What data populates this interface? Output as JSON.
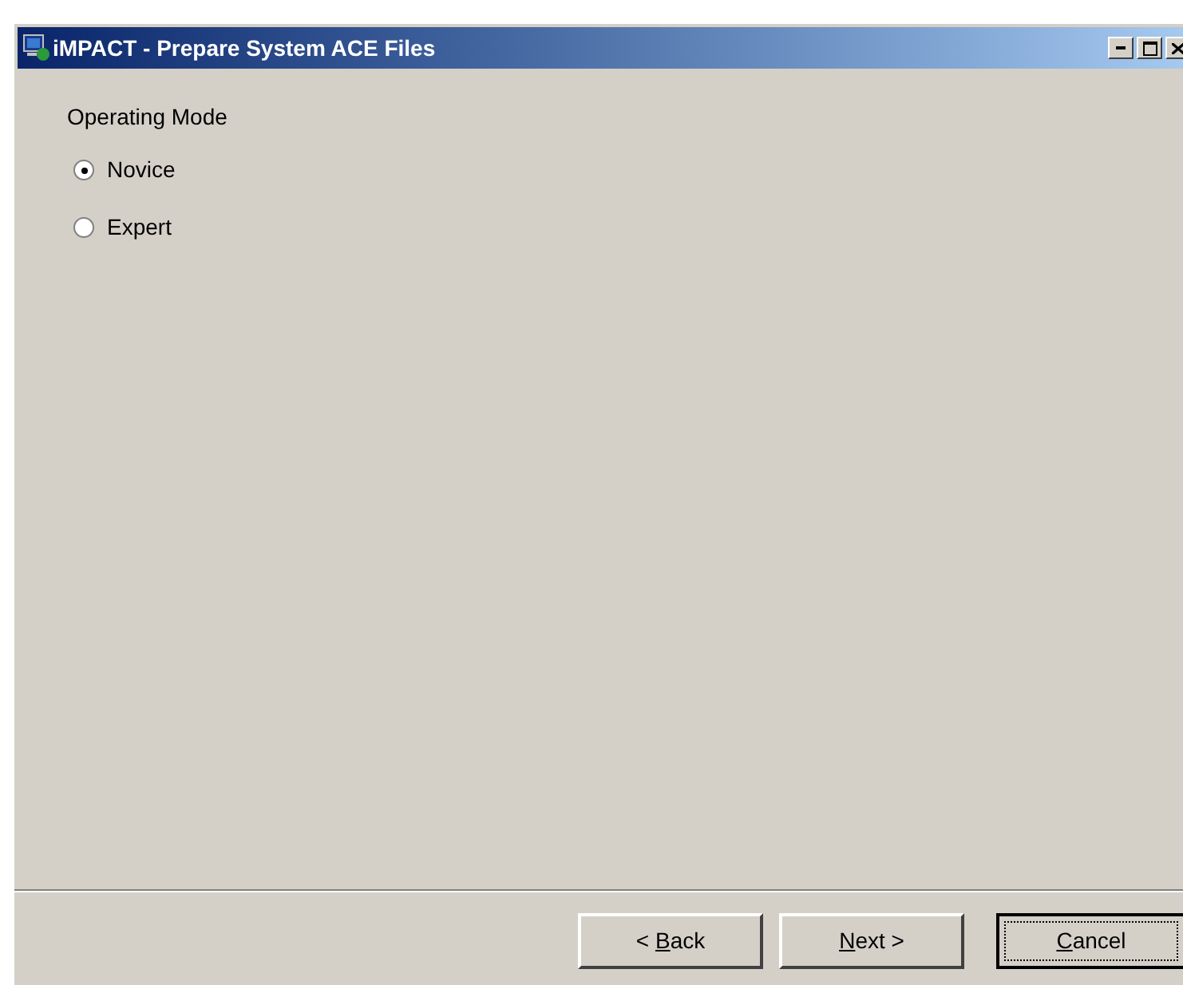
{
  "window": {
    "title": "iMPACT - Prepare System ACE Files"
  },
  "group": {
    "label": "Operating Mode"
  },
  "options": [
    {
      "label": "Novice",
      "selected": true
    },
    {
      "label": "Expert",
      "selected": false
    }
  ],
  "buttons": [
    {
      "before": "< ",
      "access_key": "B",
      "after": "ack",
      "focused": false
    },
    {
      "access_key": "N",
      "after": "ext >",
      "focused": false
    },
    {
      "access_key": "C",
      "after": "ancel",
      "focused": true
    }
  ]
}
